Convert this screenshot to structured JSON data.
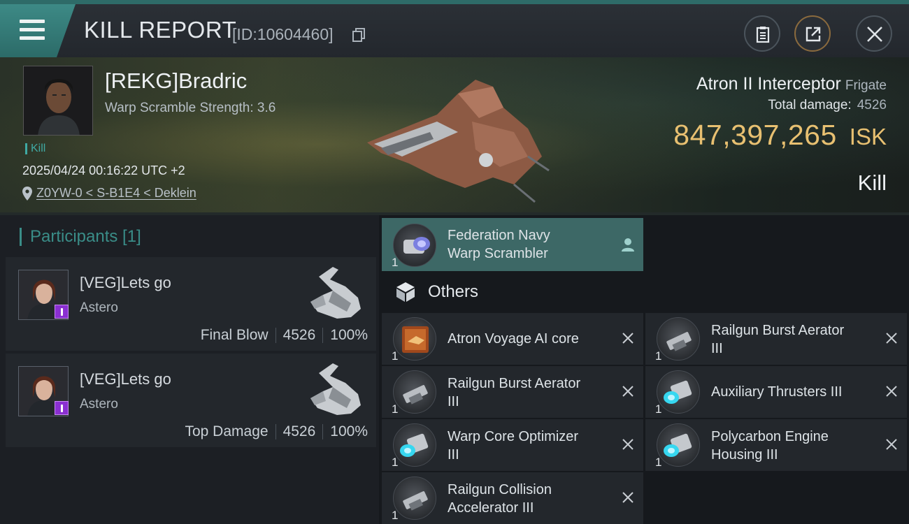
{
  "header": {
    "title": "KILL REPORT",
    "report_id": "[ID:10604460]"
  },
  "victim": {
    "name": "[REKG]Bradric",
    "scramble_strength": "Warp Scramble Strength: 3.6",
    "tag": "Kill",
    "datetime": "2025/04/24 00:16:22 UTC +2",
    "location": "Z0YW-0 < S-B1E4 < Deklein"
  },
  "ship": {
    "name": "Atron II Interceptor",
    "class": "Frigate",
    "total_damage_label": "Total damage:",
    "total_damage_value": "4526",
    "isk_value": "847,397,265",
    "isk_currency": "ISK",
    "result": "Kill"
  },
  "participants": {
    "header": "Participants [1]",
    "list": [
      {
        "name": "[VEG]Lets go",
        "ship": "Astero",
        "role": "Final Blow",
        "damage": "4526",
        "percent": "100%"
      },
      {
        "name": "[VEG]Lets go",
        "ship": "Astero",
        "role": "Top Damage",
        "damage": "4526",
        "percent": "100%"
      }
    ]
  },
  "items": {
    "weapon": {
      "line1": "Federation Navy",
      "line2": "Warp Scrambler",
      "qty": "1"
    },
    "others_label": "Others",
    "list": [
      {
        "line1": "Atron Voyage AI core",
        "line2": "",
        "qty": "1",
        "tier": "",
        "icon": "ai-core"
      },
      {
        "line1": "Railgun Burst Aerator",
        "line2": "III",
        "qty": "1",
        "tier": "III",
        "icon": "railgun"
      },
      {
        "line1": "Railgun Burst Aerator",
        "line2": "III",
        "qty": "1",
        "tier": "III",
        "icon": "railgun"
      },
      {
        "line1": "Auxiliary Thrusters III",
        "line2": "",
        "qty": "1",
        "tier": "III",
        "icon": "thruster"
      },
      {
        "line1": "Warp Core Optimizer",
        "line2": "III",
        "qty": "1",
        "tier": "III",
        "icon": "thruster"
      },
      {
        "line1": "Polycarbon Engine",
        "line2": "Housing III",
        "qty": "1",
        "tier": "III",
        "icon": "thruster"
      },
      {
        "line1": "Railgun Collision",
        "line2": "Accelerator III",
        "qty": "1",
        "tier": "III",
        "icon": "railgun"
      }
    ]
  },
  "colors": {
    "accent_teal": "#3a8d88",
    "isk_gold": "#e8c071",
    "purple_badge": "#8a2fd1"
  }
}
